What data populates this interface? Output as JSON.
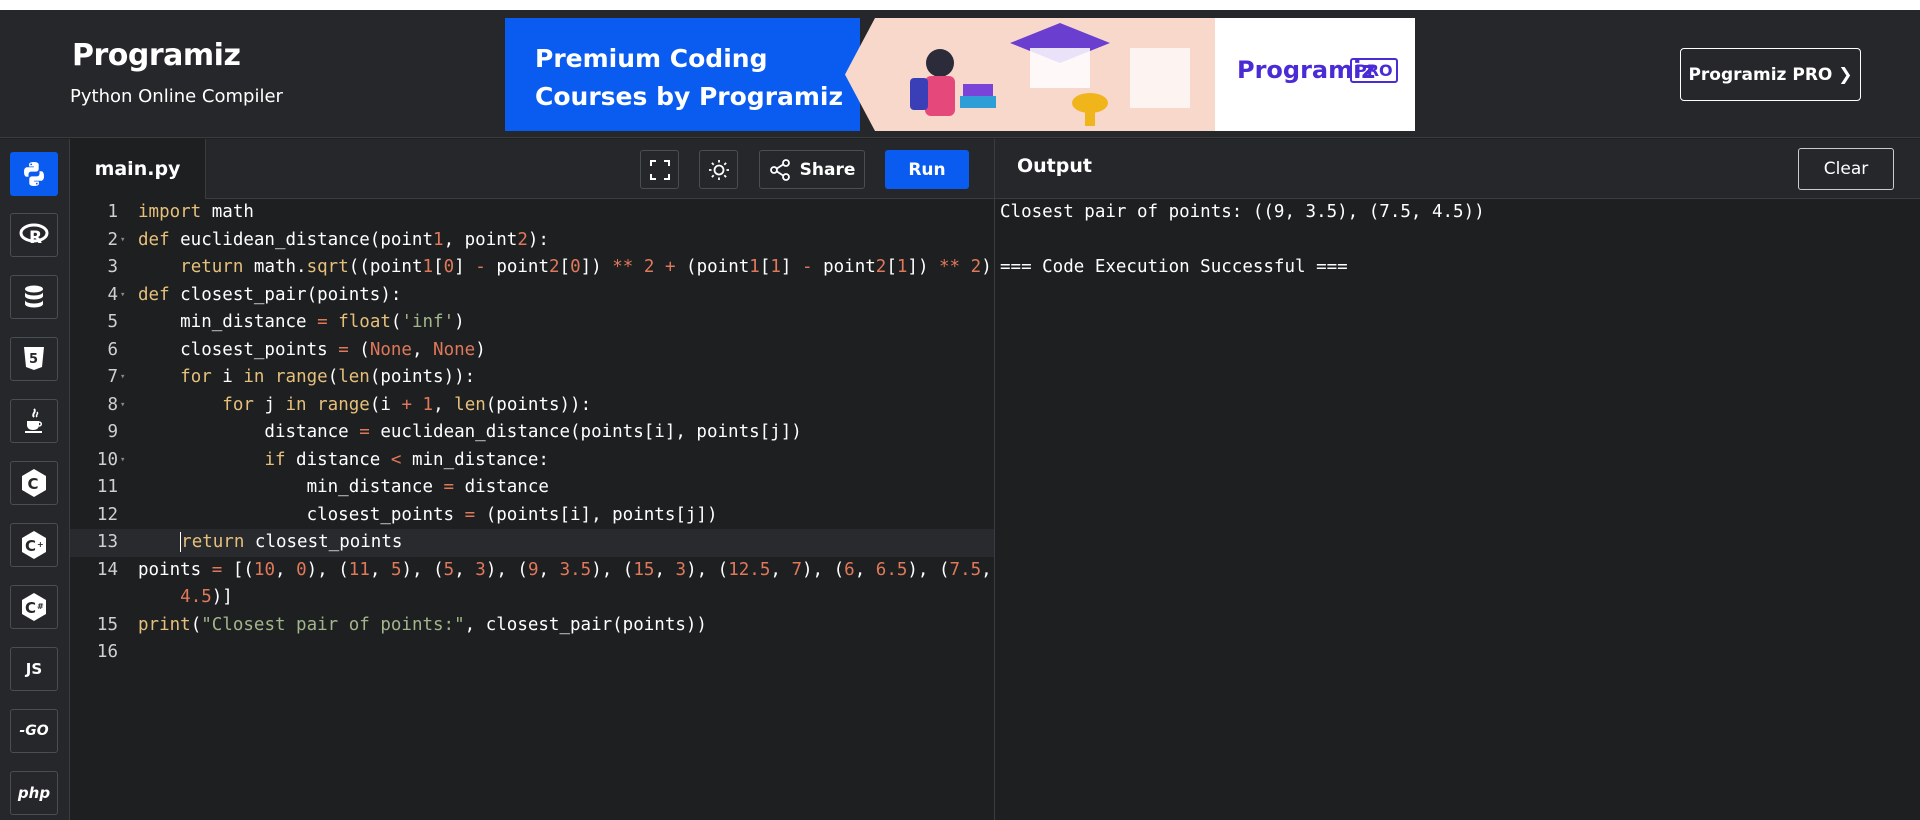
{
  "header": {
    "logo": "Programiz",
    "subtitle": "Python Online Compiler",
    "banner": {
      "line1": "Premium Coding",
      "line2": "Courses by Programiz",
      "logo": "Programiz",
      "pro_badge": "PRO"
    },
    "pro_button": "Programiz PRO ❯"
  },
  "languages": [
    {
      "name": "python-icon",
      "label": "",
      "active": true
    },
    {
      "name": "r-icon",
      "label": "R",
      "active": false
    },
    {
      "name": "sql-icon",
      "label": "",
      "active": false
    },
    {
      "name": "html5-icon",
      "label": "5",
      "active": false
    },
    {
      "name": "java-icon",
      "label": "",
      "active": false
    },
    {
      "name": "c-icon",
      "label": "C",
      "active": false
    },
    {
      "name": "cpp-icon",
      "label": "C",
      "active": false
    },
    {
      "name": "csharp-icon",
      "label": "C",
      "active": false
    },
    {
      "name": "javascript-icon",
      "label": "JS",
      "active": false
    },
    {
      "name": "go-icon",
      "label": "-GO",
      "active": false
    },
    {
      "name": "php-icon",
      "label": "php",
      "active": false
    }
  ],
  "editor": {
    "file_tab": "main.py",
    "share_label": "Share",
    "run_label": "Run",
    "line_numbers": [
      "1",
      "2",
      "3",
      "4",
      "5",
      "6",
      "7",
      "8",
      "9",
      "10",
      "11",
      "12",
      "13",
      "14",
      "15",
      "16"
    ],
    "code": [
      "import math",
      "def euclidean_distance(point1, point2):",
      "    return math.sqrt((point1[0] - point2[0]) ** 2 + (point1[1] - point2[1]) ** 2)",
      "def closest_pair(points):",
      "    min_distance = float('inf')",
      "    closest_points = (None, None)",
      "    for i in range(len(points)):",
      "        for j in range(i + 1, len(points)):",
      "            distance = euclidean_distance(points[i], points[j])",
      "            if distance < min_distance:",
      "                min_distance = distance",
      "                closest_points = (points[i], points[j])",
      "    return closest_points",
      "points = [(10, 0), (11, 5), (5, 3), (9, 3.5), (15, 3), (12.5, 7), (6, 6.5), (7.5,",
      "    4.5)]",
      "print(\"Closest pair of points:\", closest_pair(points))",
      ""
    ]
  },
  "output": {
    "title": "Output",
    "clear_label": "Clear",
    "lines": [
      "Closest pair of points: ((9, 3.5), (7.5, 4.5))",
      "",
      "=== Code Execution Successful ==="
    ]
  }
}
